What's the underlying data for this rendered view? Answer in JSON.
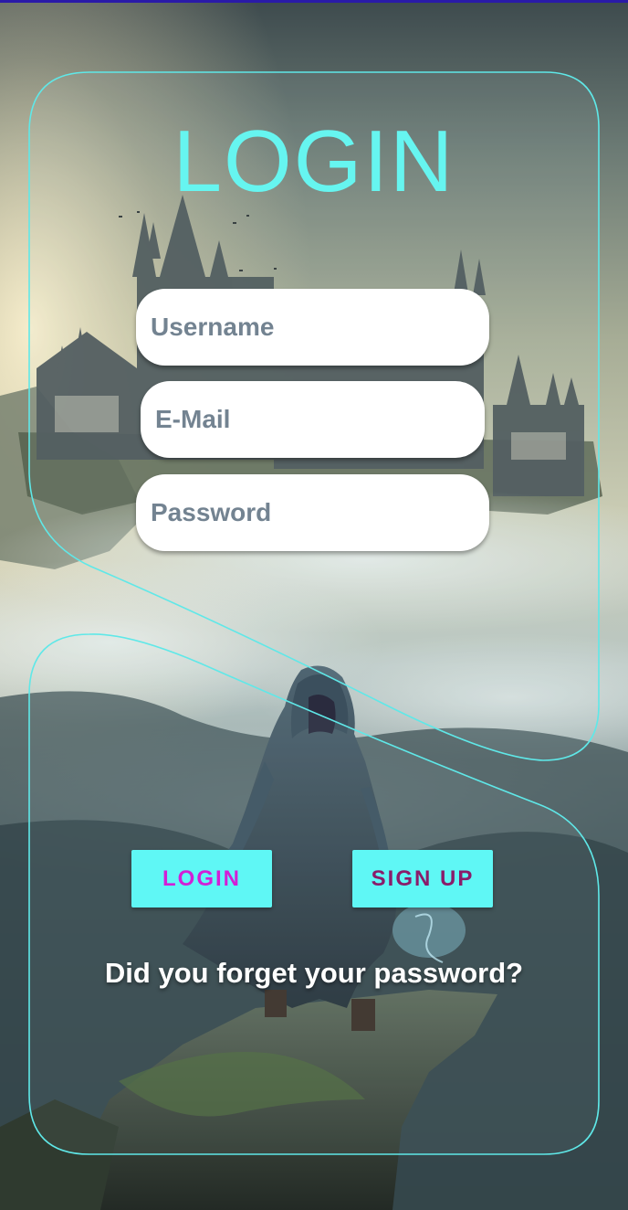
{
  "colors": {
    "accent": "#5ff7f5",
    "title": "#66f5f0",
    "login_label": "#d21fd6",
    "signup_label": "#8a1c6a",
    "card_outline": "#5fe8e8"
  },
  "header": {
    "title": "LOGIN"
  },
  "form": {
    "username": {
      "value": "",
      "placeholder": "Username"
    },
    "email": {
      "value": "",
      "placeholder": "E-Mail"
    },
    "password": {
      "value": "",
      "placeholder": "Password"
    }
  },
  "actions": {
    "login_label": "LOGIN",
    "signup_label": "SIGN UP",
    "forgot_label": "Did you forget your password?"
  },
  "background": {
    "icon": "castle-landscape-illustration"
  }
}
